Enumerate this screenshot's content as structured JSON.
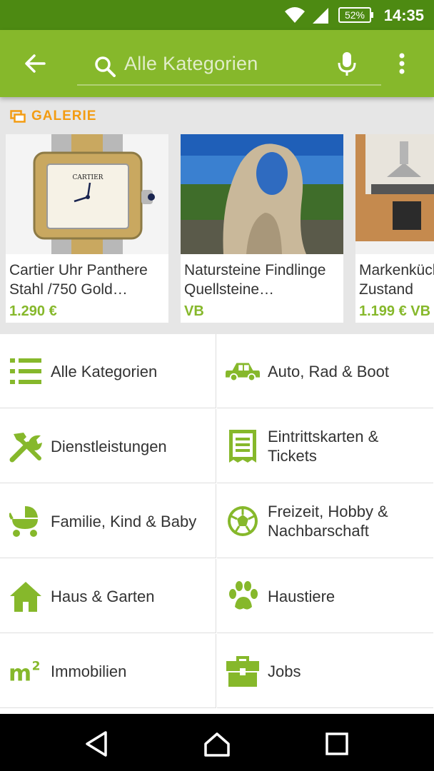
{
  "status_bar": {
    "time": "14:35",
    "battery": "52%"
  },
  "toolbar": {
    "search_placeholder": "Alle Kategorien"
  },
  "gallery": {
    "title": "GALERIE",
    "items": [
      {
        "title_line1": "Cartier Uhr Panthere",
        "title_line2": "Stahl /750 Gold…",
        "price": "1.290 €"
      },
      {
        "title_line1": "Natursteine Findlinge",
        "title_line2": "Quellsteine…",
        "price": "VB"
      },
      {
        "title_line1": "Markenküche",
        "title_line2": "Zustand",
        "price": "1.199 € VB"
      }
    ]
  },
  "categories": [
    {
      "label": "Alle Kategorien",
      "icon": "list-icon"
    },
    {
      "label": "Auto, Rad & Boot",
      "icon": "car-icon"
    },
    {
      "label": "Dienstleistungen",
      "icon": "tools-icon"
    },
    {
      "label": "Eintrittskarten & Tickets",
      "icon": "ticket-icon"
    },
    {
      "label": "Familie, Kind & Baby",
      "icon": "stroller-icon"
    },
    {
      "label": "Freizeit, Hobby & Nachbarschaft",
      "icon": "soccer-ball-icon"
    },
    {
      "label": "Haus & Garten",
      "icon": "house-icon"
    },
    {
      "label": "Haustiere",
      "icon": "paw-icon"
    },
    {
      "label": "Immobilien",
      "icon": "m2-icon"
    },
    {
      "label": "Jobs",
      "icon": "briefcase-icon"
    }
  ],
  "colors": {
    "accent": "#86b82b",
    "status_bar": "#4d8a12",
    "gallery_orange": "#f39c12"
  }
}
